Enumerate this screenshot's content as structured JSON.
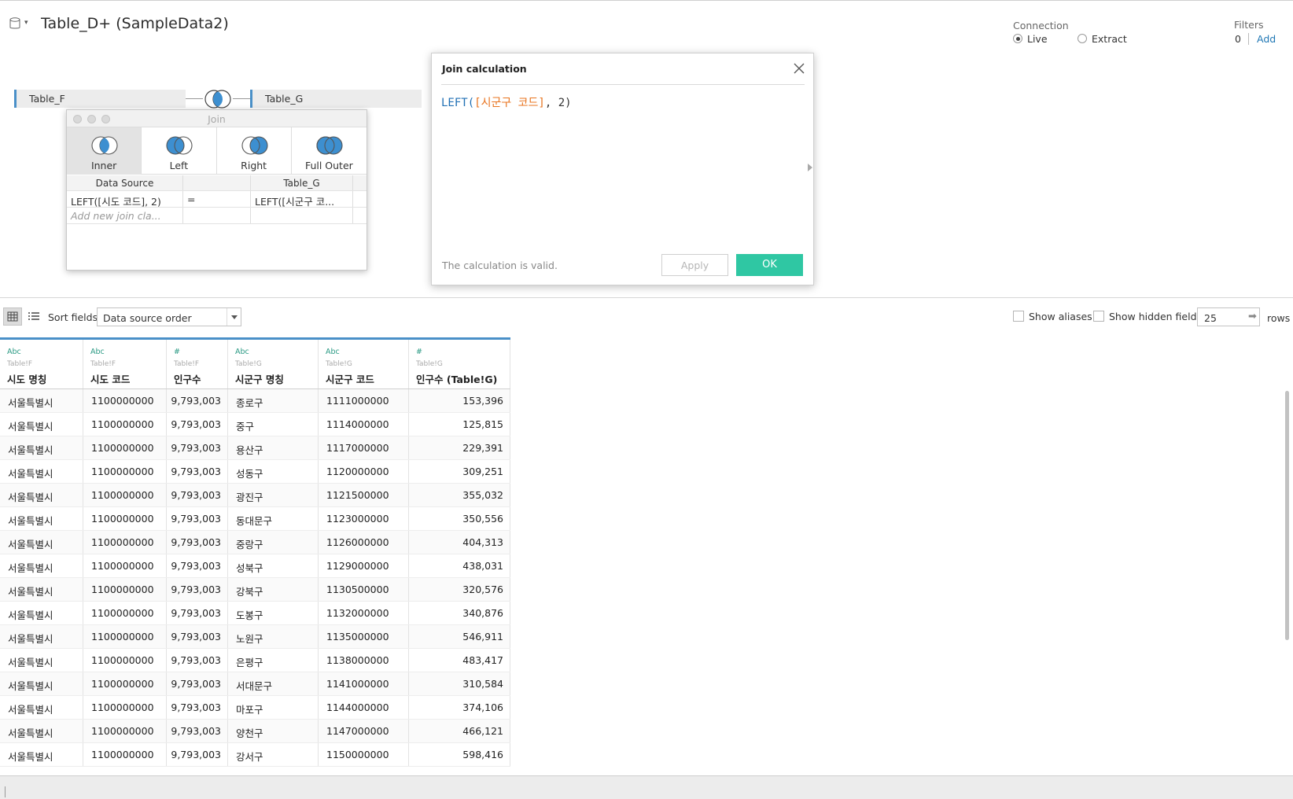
{
  "datasource": {
    "title": "Table_D+ (SampleData2)",
    "icon": "database-icon"
  },
  "connection": {
    "label": "Connection",
    "options": [
      {
        "label": "Live",
        "selected": true
      },
      {
        "label": "Extract",
        "selected": false
      }
    ]
  },
  "filters": {
    "label": "Filters",
    "count": "0",
    "add_label": "Add"
  },
  "canvas": {
    "left_table": "Table_F",
    "right_table": "Table_G"
  },
  "join_popup": {
    "title": "Join",
    "types": [
      {
        "label": "Inner",
        "icon": "inner-join-icon",
        "selected": true
      },
      {
        "label": "Left",
        "icon": "left-join-icon",
        "selected": false
      },
      {
        "label": "Right",
        "icon": "right-join-icon",
        "selected": false
      },
      {
        "label": "Full Outer",
        "icon": "full-outer-join-icon",
        "selected": false
      }
    ],
    "clause_headers": {
      "left": "Data Source",
      "right": "Table_G"
    },
    "clause": {
      "left": "LEFT([시도 코드], 2)",
      "operator": "=",
      "right": "LEFT([시군구 코..."
    },
    "add_placeholder": "Add new join cla..."
  },
  "calc_dialog": {
    "title": "Join calculation",
    "formula": {
      "fn": "LEFT(",
      "field": "[시군구 코드]",
      "rest": ", 2)"
    },
    "status": "The calculation is valid.",
    "apply_label": "Apply",
    "ok_label": "OK",
    "colors": {
      "function": "#1f6fb4",
      "field": "#e8731e",
      "ok_button": "#2fc7a3"
    }
  },
  "toolbar": {
    "sort_label": "Sort fields",
    "sort_value": "Data source order",
    "show_aliases": "Show aliases",
    "show_hidden": "Show hidden fields",
    "rows_value": "25",
    "rows_label": "rows"
  },
  "grid": {
    "columns": [
      {
        "type": "Abc",
        "source": "Table!F",
        "name": "시도 명칭"
      },
      {
        "type": "Abc",
        "source": "Table!F",
        "name": "시도 코드"
      },
      {
        "type": "#",
        "source": "Table!F",
        "name": "인구수"
      },
      {
        "type": "Abc",
        "source": "Table!G",
        "name": "시군구 명칭"
      },
      {
        "type": "Abc",
        "source": "Table!G",
        "name": "시군구 코드"
      },
      {
        "type": "#",
        "source": "Table!G",
        "name": "인구수 (Table!G)"
      }
    ],
    "rows": [
      [
        "서울특별시",
        "1100000000",
        "9,793,003",
        "종로구",
        "1111000000",
        "153,396"
      ],
      [
        "서울특별시",
        "1100000000",
        "9,793,003",
        "중구",
        "1114000000",
        "125,815"
      ],
      [
        "서울특별시",
        "1100000000",
        "9,793,003",
        "용산구",
        "1117000000",
        "229,391"
      ],
      [
        "서울특별시",
        "1100000000",
        "9,793,003",
        "성동구",
        "1120000000",
        "309,251"
      ],
      [
        "서울특별시",
        "1100000000",
        "9,793,003",
        "광진구",
        "1121500000",
        "355,032"
      ],
      [
        "서울특별시",
        "1100000000",
        "9,793,003",
        "동대문구",
        "1123000000",
        "350,556"
      ],
      [
        "서울특별시",
        "1100000000",
        "9,793,003",
        "중랑구",
        "1126000000",
        "404,313"
      ],
      [
        "서울특별시",
        "1100000000",
        "9,793,003",
        "성북구",
        "1129000000",
        "438,031"
      ],
      [
        "서울특별시",
        "1100000000",
        "9,793,003",
        "강북구",
        "1130500000",
        "320,576"
      ],
      [
        "서울특별시",
        "1100000000",
        "9,793,003",
        "도봉구",
        "1132000000",
        "340,876"
      ],
      [
        "서울특별시",
        "1100000000",
        "9,793,003",
        "노원구",
        "1135000000",
        "546,911"
      ],
      [
        "서울특별시",
        "1100000000",
        "9,793,003",
        "은평구",
        "1138000000",
        "483,417"
      ],
      [
        "서울특별시",
        "1100000000",
        "9,793,003",
        "서대문구",
        "1141000000",
        "310,584"
      ],
      [
        "서울특별시",
        "1100000000",
        "9,793,003",
        "마포구",
        "1144000000",
        "374,106"
      ],
      [
        "서울특별시",
        "1100000000",
        "9,793,003",
        "양천구",
        "1147000000",
        "466,121"
      ],
      [
        "서울특별시",
        "1100000000",
        "9,793,003",
        "강서구",
        "1150000000",
        "598,416"
      ]
    ]
  }
}
